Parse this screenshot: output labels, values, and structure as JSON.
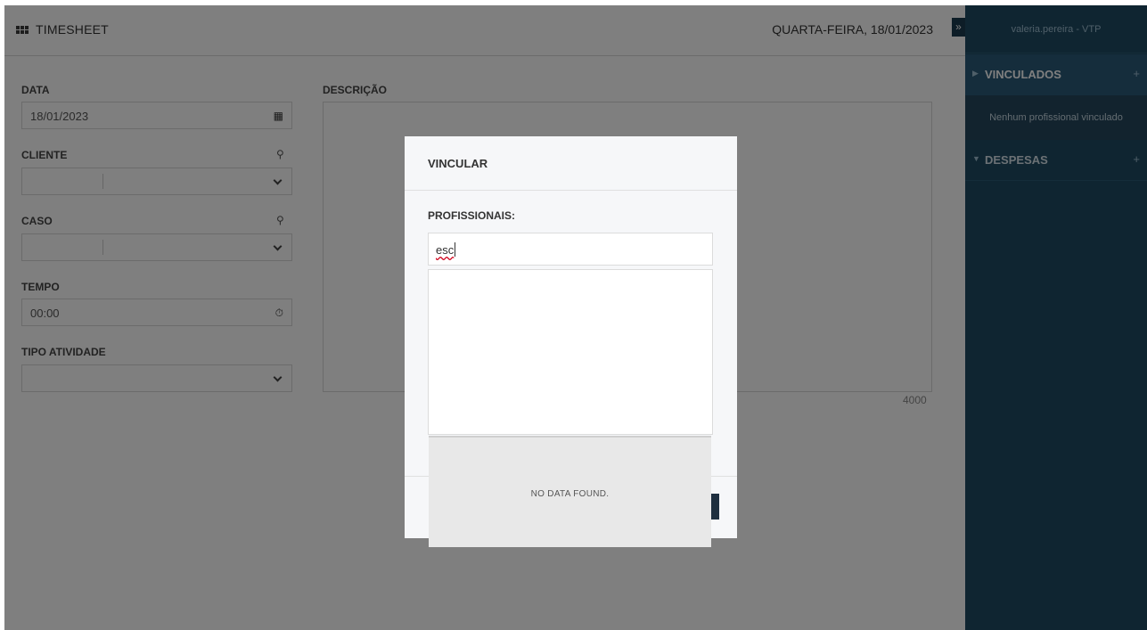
{
  "header": {
    "title": "TIMESHEET",
    "date": "QUARTA-FEIRA, 18/01/2023"
  },
  "form": {
    "data_label": "DATA",
    "data_value": "18/01/2023",
    "cliente_label": "CLIENTE",
    "caso_label": "CASO",
    "tempo_label": "TEMPO",
    "tempo_value": "00:00",
    "tipo_atividade_label": "TIPO ATIVIDADE",
    "descricao_label": "DESCRIÇÃO",
    "descricao_counter": "4000"
  },
  "sidebar": {
    "toggle_glyph": "»",
    "user": "valeria.pereira - VTP",
    "vinculados": {
      "label": "VINCULADOS",
      "empty_text": "Nenhum profissional vinculado"
    },
    "despesas": {
      "label": "DESPESAS"
    },
    "plus_glyph": "+"
  },
  "modal": {
    "title": "VINCULAR",
    "field_label": "PROFISSIONAIS:",
    "search_value": "esc",
    "dropdown_empty": "NO DATA FOUND."
  },
  "colors": {
    "sidebar_bg": "#1f4a62",
    "sidebar_active": "#2a5a78",
    "overlay": "rgba(0,0,0,0.5)",
    "primary_button": "#1e2f3f"
  }
}
